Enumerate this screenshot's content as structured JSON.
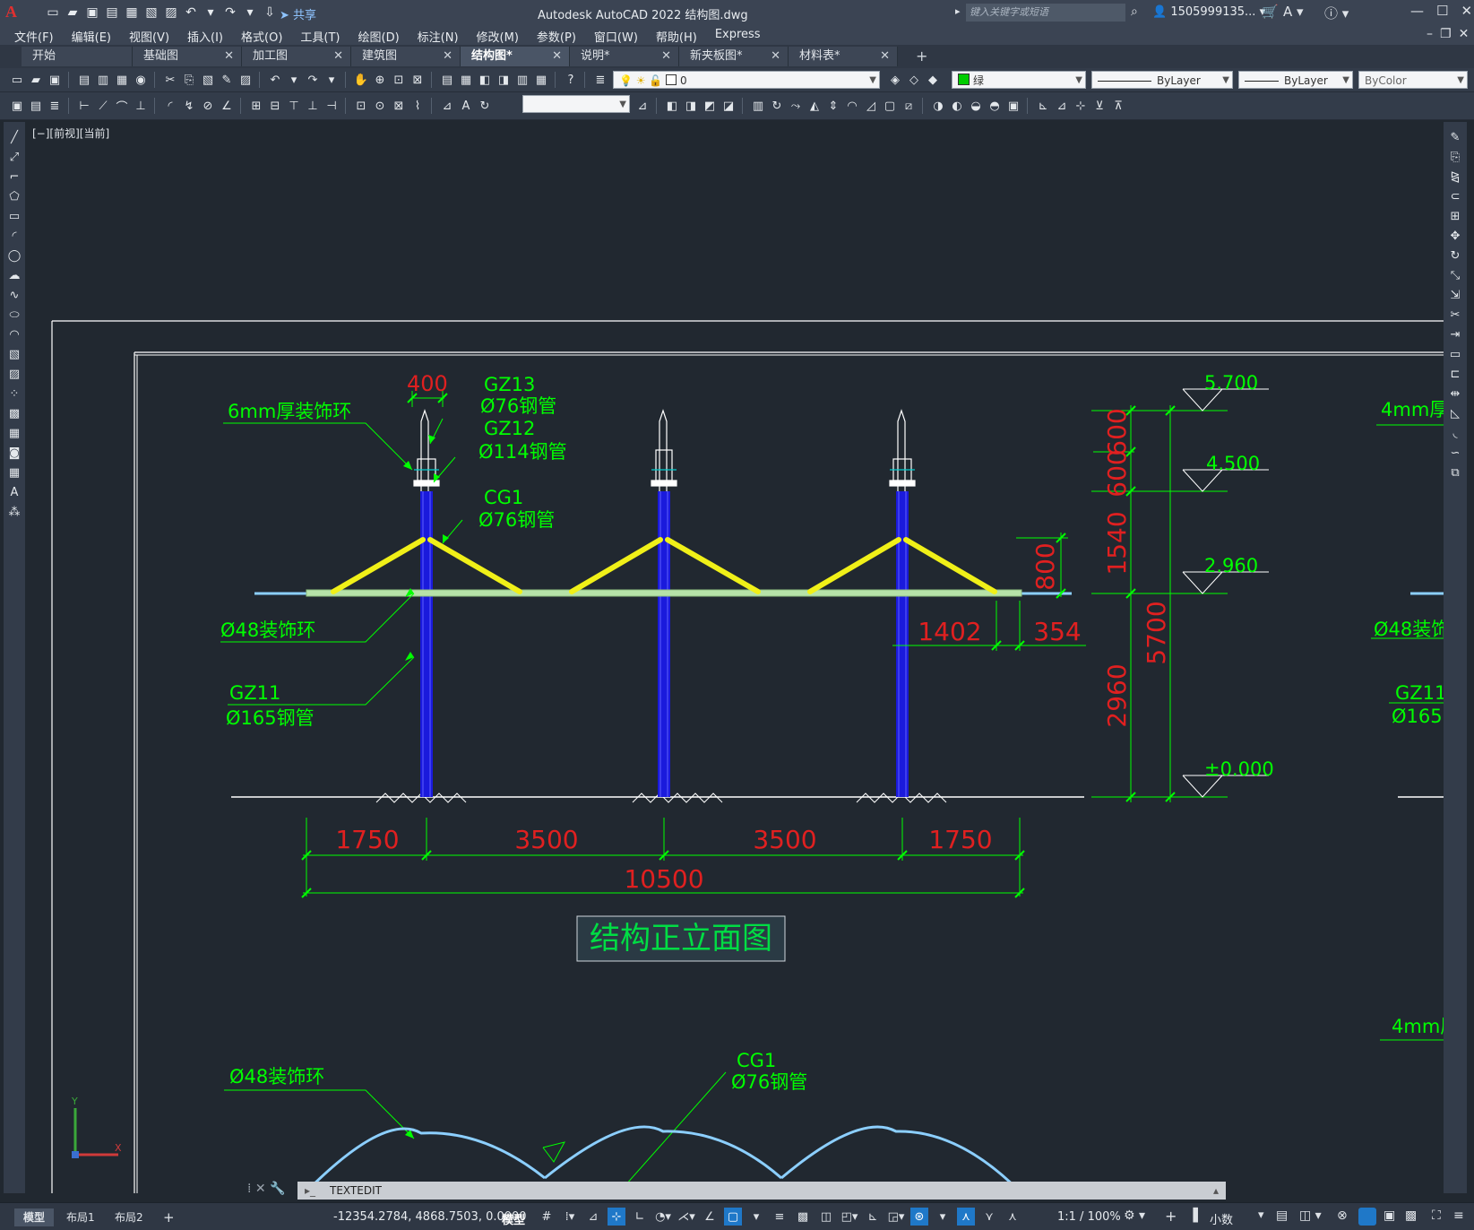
{
  "app": {
    "title": "Autodesk AutoCAD 2022    结构图.dwg",
    "share": "共享",
    "search_placeholder": "键入关键字或短语",
    "user": "1505999135...",
    "icon_letter": "A"
  },
  "menu": [
    "文件(F)",
    "编辑(E)",
    "视图(V)",
    "插入(I)",
    "格式(O)",
    "工具(T)",
    "绘图(D)",
    "标注(N)",
    "修改(M)",
    "参数(P)",
    "窗口(W)",
    "帮助(H)",
    "Express"
  ],
  "tabs": [
    {
      "label": "开始",
      "closable": false
    },
    {
      "label": "基础图",
      "closable": true
    },
    {
      "label": "加工图",
      "closable": true
    },
    {
      "label": "建筑图",
      "closable": true
    },
    {
      "label": "结构图*",
      "closable": true,
      "active": true
    },
    {
      "label": "说明*",
      "closable": true
    },
    {
      "label": "新夹板图*",
      "closable": true
    },
    {
      "label": "材料表*",
      "closable": true
    }
  ],
  "layer": {
    "name": "0"
  },
  "properties": {
    "color": "绿",
    "linetype": "ByLayer",
    "lineweight": "ByLayer",
    "plotstyle": "ByColor",
    "color_hex": "#00cc00"
  },
  "viewport_label": "[−][前视][当前]",
  "drawing": {
    "labels": {
      "ring6": "6mm厚装饰环",
      "gz13": "GZ13",
      "gz13_spec": "Ø76钢管",
      "gz12": "GZ12",
      "gz12_spec": "Ø114钢管",
      "cg1": "CG1",
      "cg1_spec": "Ø76钢管",
      "ring48": "Ø48装饰环",
      "gz11": "GZ11",
      "gz11_spec": "Ø165钢管",
      "ring4_partial": "4mm厚",
      "ring48_partial": "Ø48装饰",
      "gz11_partial": "GZ11",
      "gz11_spec_partial": "Ø165",
      "ring4_partial2": "4mm厚",
      "title": "结构正立面图",
      "ring48_bottom": "Ø48装饰环",
      "cg1_bottom": "CG1",
      "cg1_bottom_spec": "Ø76钢管"
    },
    "dims": {
      "d400": "400",
      "d600a": "600",
      "d600b": "600",
      "d1540": "1540",
      "d2960": "2960",
      "d5700": "5700",
      "d800": "800",
      "d1402": "1402",
      "d354": "354",
      "d1750a": "1750",
      "d3500a": "3500",
      "d3500b": "3500",
      "d1750b": "1750",
      "d10500": "10500"
    },
    "elevations": [
      "5.700",
      "4.500",
      "2.960",
      "±0.000"
    ]
  },
  "command": {
    "text": "TEXTEDIT"
  },
  "status": {
    "layouts": [
      "模型",
      "布局1",
      "布局2"
    ],
    "coords": "-12354.2784, 4868.7503, 0.0000",
    "space": "模型",
    "scale": "1:1 / 100%",
    "units": "小数"
  }
}
